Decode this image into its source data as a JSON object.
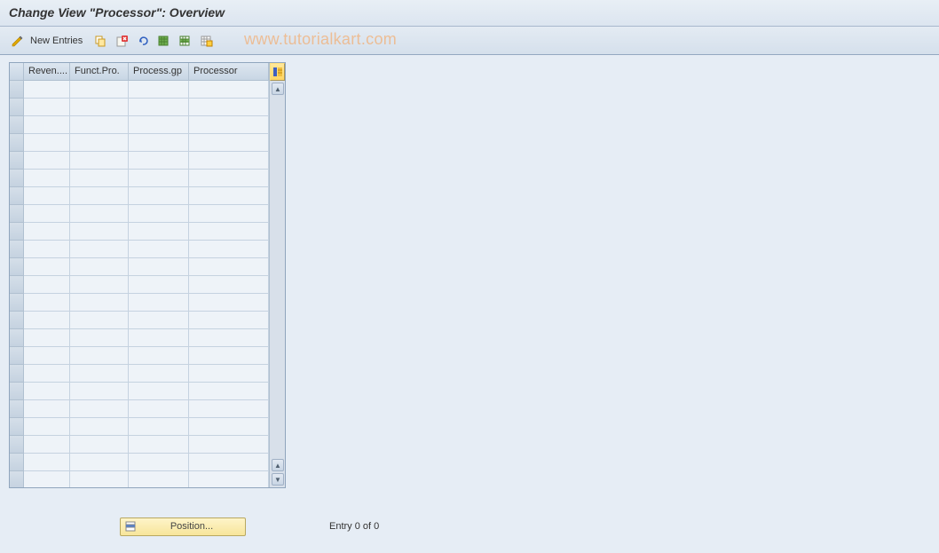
{
  "title": "Change View \"Processor\": Overview",
  "toolbar": {
    "new_entries": "New Entries",
    "icons": {
      "display_change": "display-change-icon",
      "copy": "copy-icon",
      "delete": "delete-icon",
      "undo": "undo-icon",
      "select_all": "select-all-icon",
      "select_block": "select-block-icon",
      "deselect_all": "deselect-all-icon"
    }
  },
  "watermark": "www.tutorialkart.com",
  "table": {
    "columns": [
      {
        "label": "Reven....",
        "key": "revenue"
      },
      {
        "label": "Funct.Pro.",
        "key": "funct_pro"
      },
      {
        "label": "Process.gp",
        "key": "process_gp"
      },
      {
        "label": "Processor",
        "key": "processor"
      }
    ],
    "rows": []
  },
  "footer": {
    "position_label": "Position...",
    "status": "Entry 0 of 0"
  }
}
